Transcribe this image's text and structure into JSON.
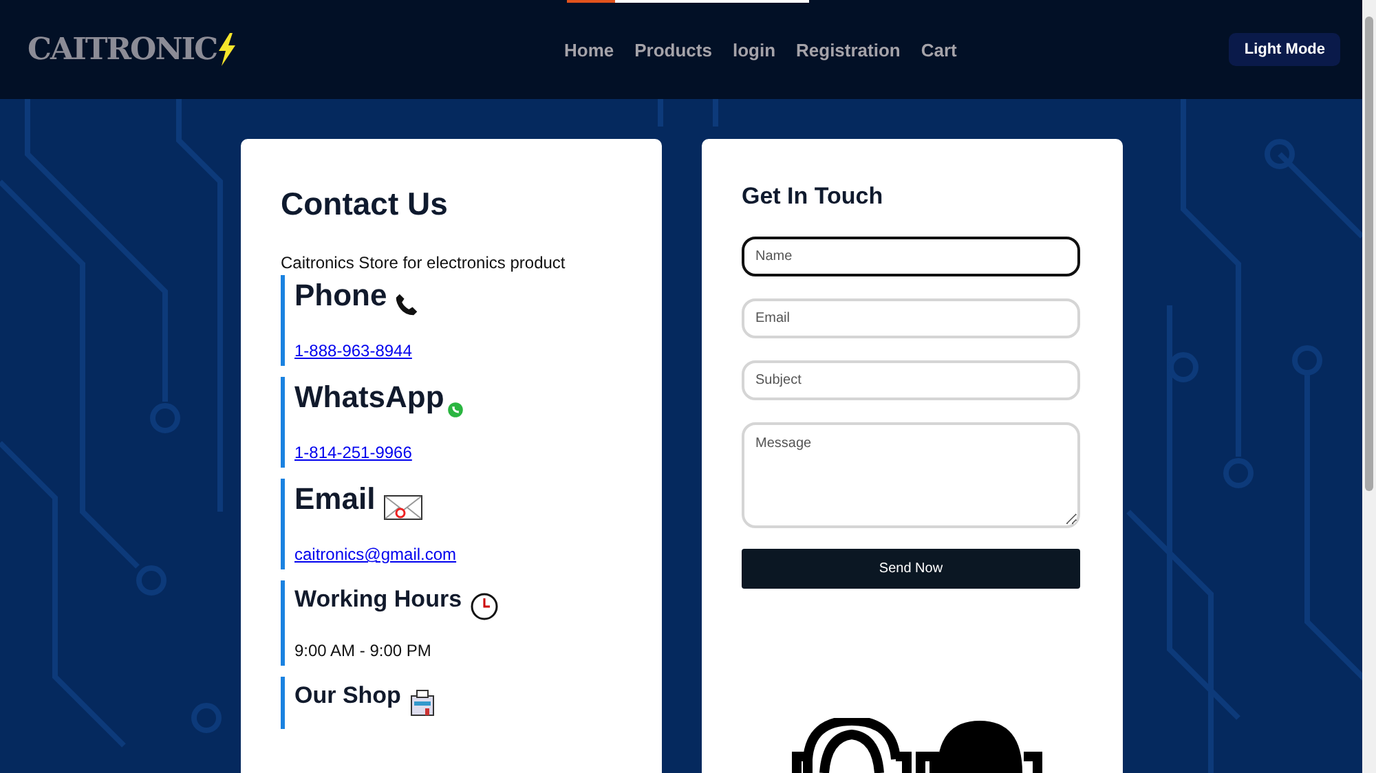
{
  "top_progress": {
    "level": 0.2
  },
  "header": {
    "logo": "CAITRONIC",
    "nav": [
      {
        "label": "Home"
      },
      {
        "label": "Products"
      },
      {
        "label": "login"
      },
      {
        "label": "Registration"
      },
      {
        "label": "Cart"
      }
    ],
    "theme_button": "Light Mode"
  },
  "contact": {
    "title": "Contact Us",
    "subtitle": "Caitronics Store for electronics product",
    "items": [
      {
        "kind": "phone",
        "heading": "Phone",
        "value": "1-888-963-8944"
      },
      {
        "kind": "whatsapp",
        "heading": "WhatsApp",
        "value": "1-814-251-9966"
      },
      {
        "kind": "email",
        "heading": "Email",
        "value": "caitronics@gmail.com"
      },
      {
        "kind": "clock",
        "heading": "Working Hours",
        "value": "9:00 AM - 9:00 PM"
      },
      {
        "kind": "shop",
        "heading": "Our Shop"
      }
    ]
  },
  "form": {
    "title": "Get In Touch",
    "fields": [
      {
        "kind": "input",
        "placeholder": "Name",
        "focused": true
      },
      {
        "kind": "input",
        "placeholder": "Email",
        "focused": false
      },
      {
        "kind": "input",
        "placeholder": "Subject",
        "focused": false
      },
      {
        "kind": "textarea",
        "placeholder": "Message",
        "focused": false
      }
    ],
    "submit": "Send Now"
  }
}
